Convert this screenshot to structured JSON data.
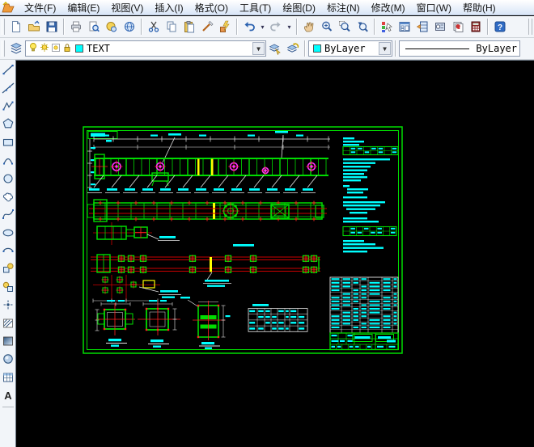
{
  "menu_bar": {
    "items": [
      {
        "name": "file",
        "label": "文件(F)"
      },
      {
        "name": "edit",
        "label": "编辑(E)"
      },
      {
        "name": "view",
        "label": "视图(V)"
      },
      {
        "name": "insert",
        "label": "插入(I)"
      },
      {
        "name": "format",
        "label": "格式(O)"
      },
      {
        "name": "tools",
        "label": "工具(T)"
      },
      {
        "name": "draw",
        "label": "绘图(D)"
      },
      {
        "name": "dimension",
        "label": "标注(N)"
      },
      {
        "name": "modify",
        "label": "修改(M)"
      },
      {
        "name": "window",
        "label": "窗口(W)"
      },
      {
        "name": "help",
        "label": "帮助(H)"
      }
    ]
  },
  "standard_toolbar": {
    "buttons": [
      {
        "name": "new",
        "icon": "new-file-icon"
      },
      {
        "name": "open",
        "icon": "open-folder-icon"
      },
      {
        "name": "save",
        "icon": "save-icon"
      },
      {
        "sep": true
      },
      {
        "name": "print",
        "icon": "print-icon"
      },
      {
        "name": "print-preview",
        "icon": "print-preview-icon"
      },
      {
        "name": "publish",
        "icon": "publish-icon"
      },
      {
        "name": "publish-to-web",
        "icon": "web-icon"
      },
      {
        "sep": true
      },
      {
        "name": "cut",
        "icon": "cut-icon"
      },
      {
        "name": "copy",
        "icon": "copy-icon"
      },
      {
        "name": "paste",
        "icon": "paste-icon"
      },
      {
        "name": "match-properties",
        "icon": "match-properties-icon"
      },
      {
        "name": "block-editor",
        "icon": "block-editor-icon"
      },
      {
        "sep": true
      },
      {
        "name": "undo",
        "icon": "undo-icon"
      },
      {
        "name": "undo-list",
        "drop": true
      },
      {
        "name": "redo",
        "icon": "redo-icon"
      },
      {
        "name": "redo-list",
        "drop": true
      },
      {
        "sep": true
      },
      {
        "name": "pan",
        "icon": "pan-icon"
      },
      {
        "name": "zoom-realtime",
        "icon": "zoom-realtime-icon"
      },
      {
        "name": "zoom-window",
        "icon": "zoom-window-icon"
      },
      {
        "name": "zoom-previous",
        "icon": "zoom-previous-icon"
      },
      {
        "sep": true
      },
      {
        "name": "properties",
        "icon": "properties-icon"
      },
      {
        "name": "design-center",
        "icon": "design-center-icon"
      },
      {
        "name": "tool-palettes",
        "icon": "tool-palettes-icon"
      },
      {
        "name": "sheet-set-manager",
        "icon": "sheet-set-icon"
      },
      {
        "name": "markup-set-manager",
        "icon": "markup-set-icon"
      },
      {
        "name": "quick-calc",
        "icon": "quick-calc-icon"
      },
      {
        "sep": true
      },
      {
        "name": "help",
        "icon": "help-icon"
      }
    ]
  },
  "properties_toolbar": {
    "layers_button": {
      "name": "layers",
      "icon": "layers-icon"
    },
    "layer_combo": {
      "value": "TEXT",
      "swatch_color": "#00FFFF",
      "state_icons": [
        "lightbulb-icon",
        "sun-icon",
        "viewport-sun-icon",
        "lock-icon"
      ]
    },
    "right_buttons": [
      {
        "name": "make-object-layer-current",
        "icon": "make-layer-current-icon"
      },
      {
        "name": "layer-previous",
        "icon": "layer-previous-icon"
      }
    ],
    "color_combo": {
      "value": "ByLayer",
      "swatch_color": "#00FFFF"
    },
    "linetype_combo": {
      "value": "ByLayer"
    }
  },
  "draw_toolbar": {
    "tools": [
      {
        "name": "line",
        "icon": "line-icon"
      },
      {
        "name": "construction-line",
        "icon": "construction-line-icon"
      },
      {
        "name": "polyline",
        "icon": "polyline-icon"
      },
      {
        "name": "polygon",
        "icon": "polygon-icon"
      },
      {
        "name": "rectangle",
        "icon": "rectangle-icon"
      },
      {
        "name": "arc",
        "icon": "arc-icon"
      },
      {
        "name": "circle",
        "icon": "circle-icon"
      },
      {
        "name": "revision-cloud",
        "icon": "revcloud-icon"
      },
      {
        "name": "spline",
        "icon": "spline-icon"
      },
      {
        "name": "ellipse",
        "icon": "ellipse-icon"
      },
      {
        "name": "ellipse-arc",
        "icon": "ellipse-arc-icon"
      },
      {
        "name": "insert-block",
        "icon": "insert-block-icon"
      },
      {
        "name": "make-block",
        "icon": "make-block-icon"
      },
      {
        "name": "point",
        "icon": "point-icon"
      },
      {
        "name": "hatch",
        "icon": "hatch-icon"
      },
      {
        "name": "gradient",
        "icon": "gradient-icon"
      },
      {
        "name": "region",
        "icon": "region-icon"
      },
      {
        "name": "table",
        "icon": "table-icon"
      },
      {
        "name": "multiline-text",
        "icon": "mtext-icon"
      }
    ]
  },
  "canvas": {
    "background": "#000000",
    "palette": {
      "green": "#00DC00",
      "cyan": "#00FFFF",
      "red": "#FF2222",
      "dark_red": "#CC0000",
      "yellow": "#FFFF00",
      "magenta": "#FF30FF",
      "white": "#E8E8E8"
    }
  }
}
